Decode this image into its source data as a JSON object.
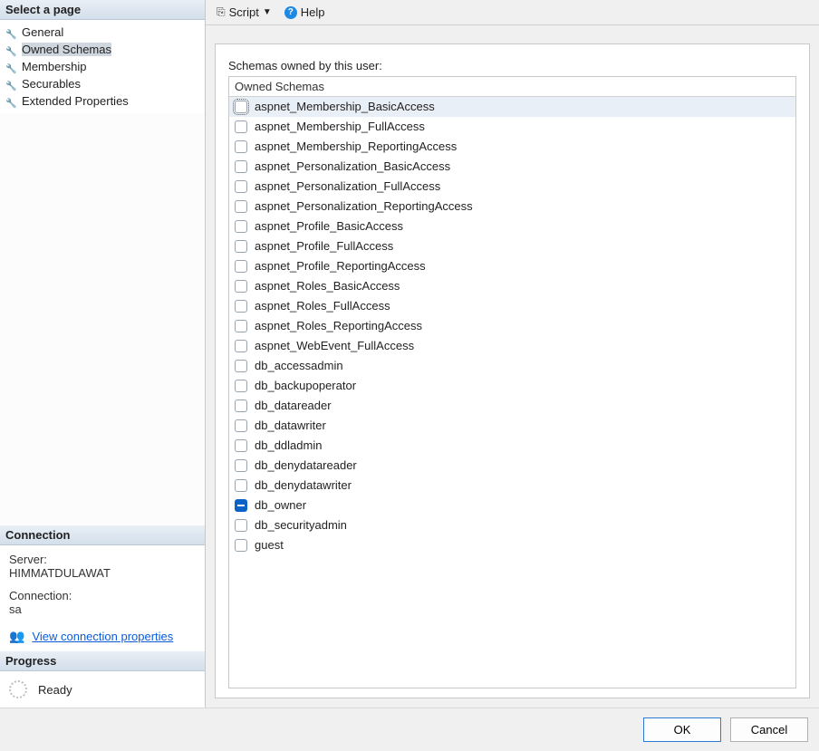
{
  "sidebar": {
    "select_page_header": "Select a page",
    "pages": [
      {
        "label": "General",
        "selected": false
      },
      {
        "label": "Owned Schemas",
        "selected": true
      },
      {
        "label": "Membership",
        "selected": false
      },
      {
        "label": "Securables",
        "selected": false
      },
      {
        "label": "Extended Properties",
        "selected": false
      }
    ],
    "connection_header": "Connection",
    "connection": {
      "server_label": "Server:",
      "server_value": "HIMMATDULAWAT",
      "connection_label": "Connection:",
      "connection_value": "sa",
      "view_properties_link": "View connection properties"
    },
    "progress_header": "Progress",
    "progress_status": "Ready"
  },
  "toolbar": {
    "script_label": "Script",
    "help_label": "Help"
  },
  "main": {
    "field_label": "Schemas owned by this user:",
    "column_header": "Owned Schemas",
    "schemas": [
      {
        "name": "aspnet_Membership_BasicAccess",
        "state": "unchecked",
        "selected": true,
        "focused": true
      },
      {
        "name": "aspnet_Membership_FullAccess",
        "state": "unchecked"
      },
      {
        "name": "aspnet_Membership_ReportingAccess",
        "state": "unchecked"
      },
      {
        "name": "aspnet_Personalization_BasicAccess",
        "state": "unchecked"
      },
      {
        "name": "aspnet_Personalization_FullAccess",
        "state": "unchecked"
      },
      {
        "name": "aspnet_Personalization_ReportingAccess",
        "state": "unchecked"
      },
      {
        "name": "aspnet_Profile_BasicAccess",
        "state": "unchecked"
      },
      {
        "name": "aspnet_Profile_FullAccess",
        "state": "unchecked"
      },
      {
        "name": "aspnet_Profile_ReportingAccess",
        "state": "unchecked"
      },
      {
        "name": "aspnet_Roles_BasicAccess",
        "state": "unchecked"
      },
      {
        "name": "aspnet_Roles_FullAccess",
        "state": "unchecked"
      },
      {
        "name": "aspnet_Roles_ReportingAccess",
        "state": "unchecked"
      },
      {
        "name": "aspnet_WebEvent_FullAccess",
        "state": "unchecked"
      },
      {
        "name": "db_accessadmin",
        "state": "unchecked"
      },
      {
        "name": "db_backupoperator",
        "state": "unchecked"
      },
      {
        "name": "db_datareader",
        "state": "unchecked"
      },
      {
        "name": "db_datawriter",
        "state": "unchecked"
      },
      {
        "name": "db_ddladmin",
        "state": "unchecked"
      },
      {
        "name": "db_denydatareader",
        "state": "unchecked"
      },
      {
        "name": "db_denydatawriter",
        "state": "unchecked"
      },
      {
        "name": "db_owner",
        "state": "indeterminate"
      },
      {
        "name": "db_securityadmin",
        "state": "unchecked"
      },
      {
        "name": "guest",
        "state": "unchecked"
      }
    ]
  },
  "footer": {
    "ok_label": "OK",
    "cancel_label": "Cancel"
  }
}
